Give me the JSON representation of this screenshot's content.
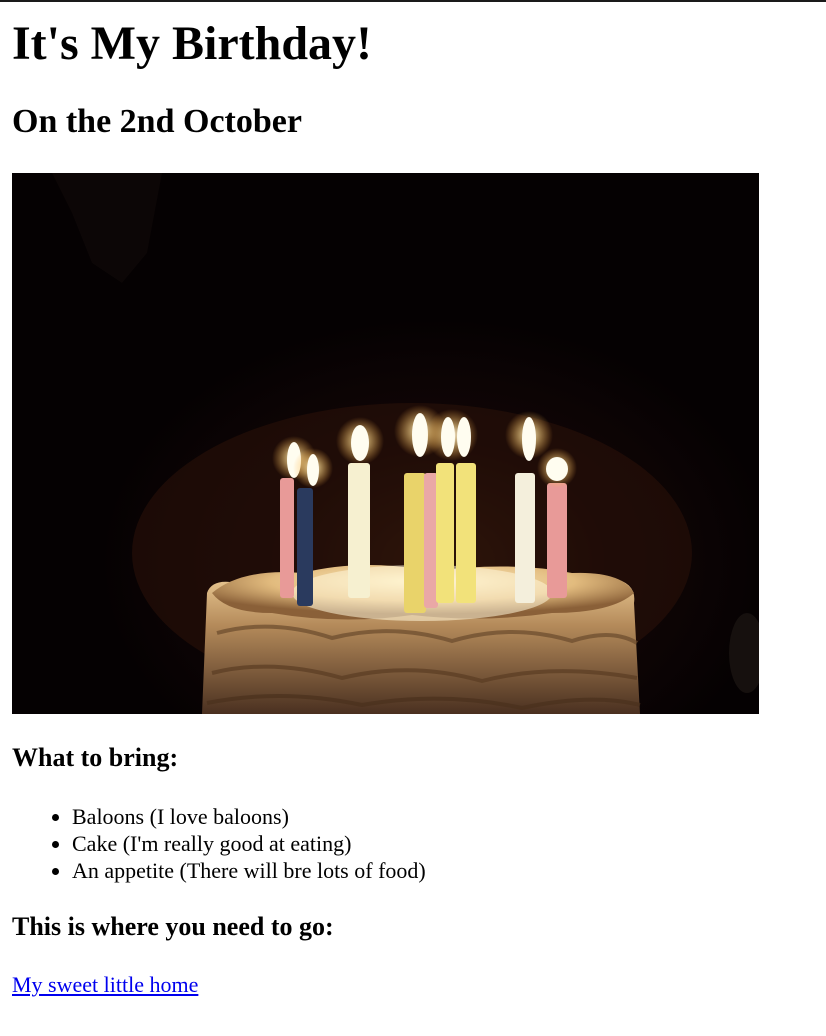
{
  "header": {
    "title": "It's My Birthday!",
    "subtitle": "On the 2nd October"
  },
  "hero_image": {
    "description_icon": "birthday-cake-with-candles-image"
  },
  "bring_section": {
    "heading": "What to bring:",
    "items": [
      "Baloons (I love baloons)",
      "Cake (I'm really good at eating)",
      "An appetite (There will bre lots of food)"
    ]
  },
  "location_section": {
    "heading": "This is where you need to go:",
    "link_text": "My sweet little home"
  },
  "colors": {
    "link": "#0000ee",
    "text": "#000000",
    "background": "#ffffff"
  }
}
